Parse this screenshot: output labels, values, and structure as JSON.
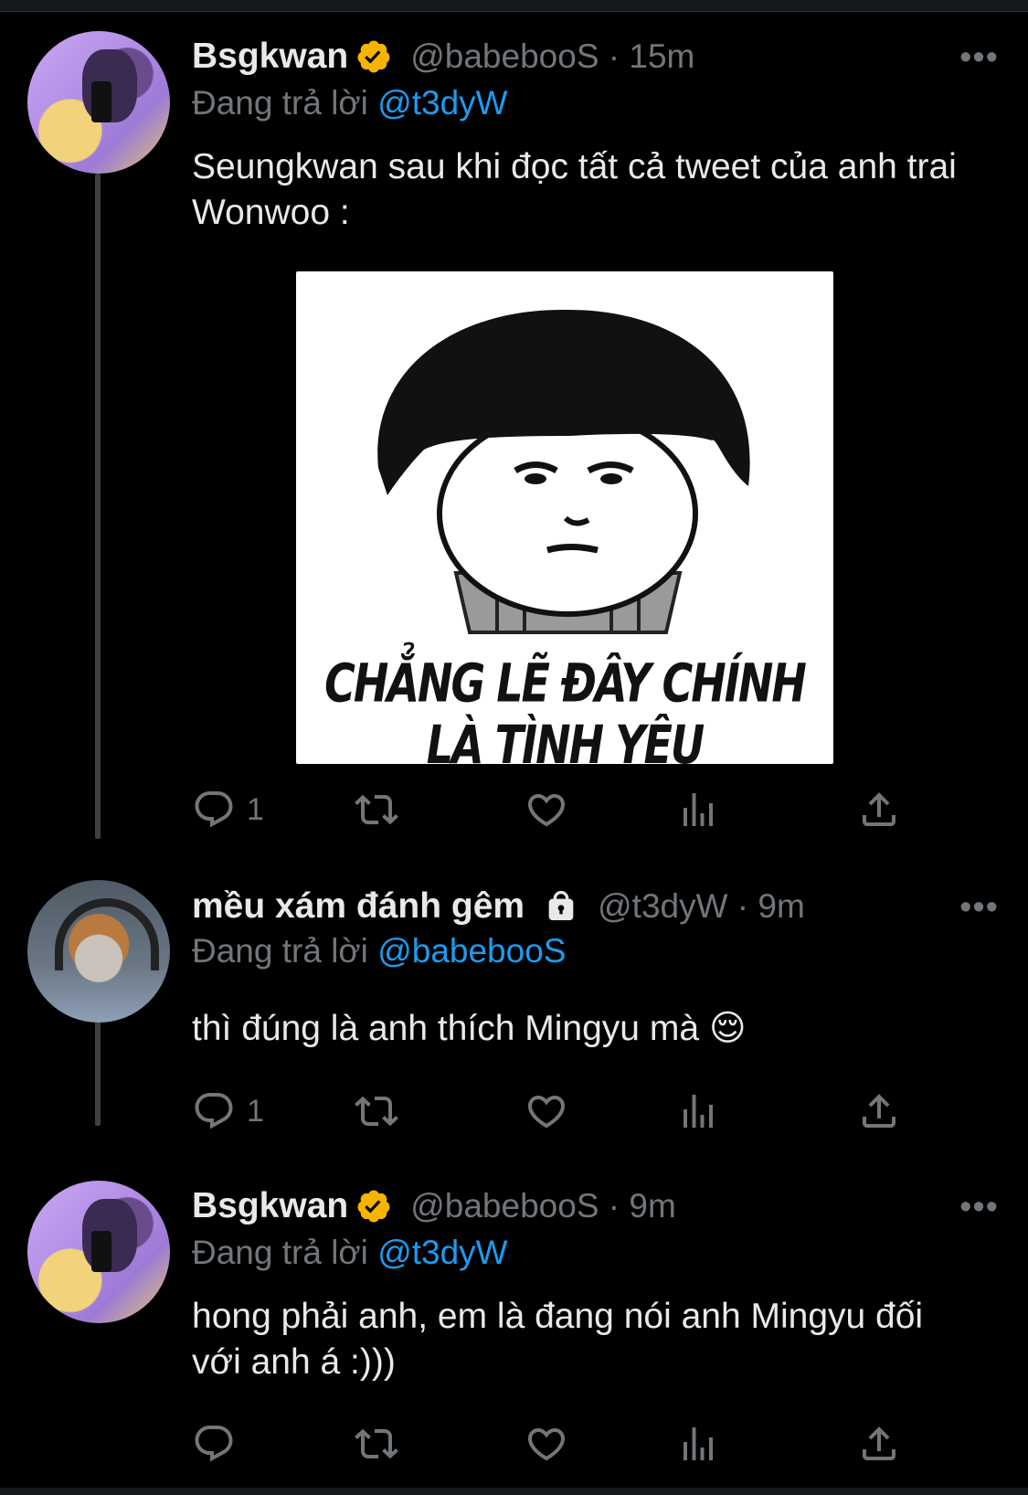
{
  "tweets": [
    {
      "display_name": "Bsgkwan",
      "handle_time": "@babebooS · 15m",
      "replying_prefix": "Đang trả lời",
      "replying_to": "@t3dyW",
      "text": "Seungkwan sau khi đọc tất cả tweet của anh trai Wonwoo :",
      "image_caption": "CHẲNG LẼ ĐÂY CHÍNH LÀ TÌNH YÊU",
      "reply_count": "1",
      "verified": true
    },
    {
      "display_name": "mều xám đánh gêm",
      "handle_time": "@t3dyW · 9m",
      "replying_prefix": "Đang trả lời",
      "replying_to": "@babebooS",
      "text": "thì đúng là anh thích Mingyu mà 😌",
      "reply_count": "1",
      "protected": true
    },
    {
      "display_name": "Bsgkwan",
      "handle_time": "@babebooS · 9m",
      "replying_prefix": "Đang trả lời",
      "replying_to": "@t3dyW",
      "text": "hong phải anh, em là đang nói anh Mingyu đối với anh á :)))",
      "reply_count": "",
      "verified": true
    }
  ],
  "icons": {
    "more": "more-dots-icon",
    "reply": "reply-icon",
    "retweet": "retweet-icon",
    "like": "heart-icon",
    "views": "views-icon",
    "share": "share-icon"
  },
  "colors": {
    "background": "#000000",
    "text": "#e7e9ea",
    "secondary": "#71767b",
    "link": "#1d9bf0",
    "verified": "#f4b400"
  }
}
